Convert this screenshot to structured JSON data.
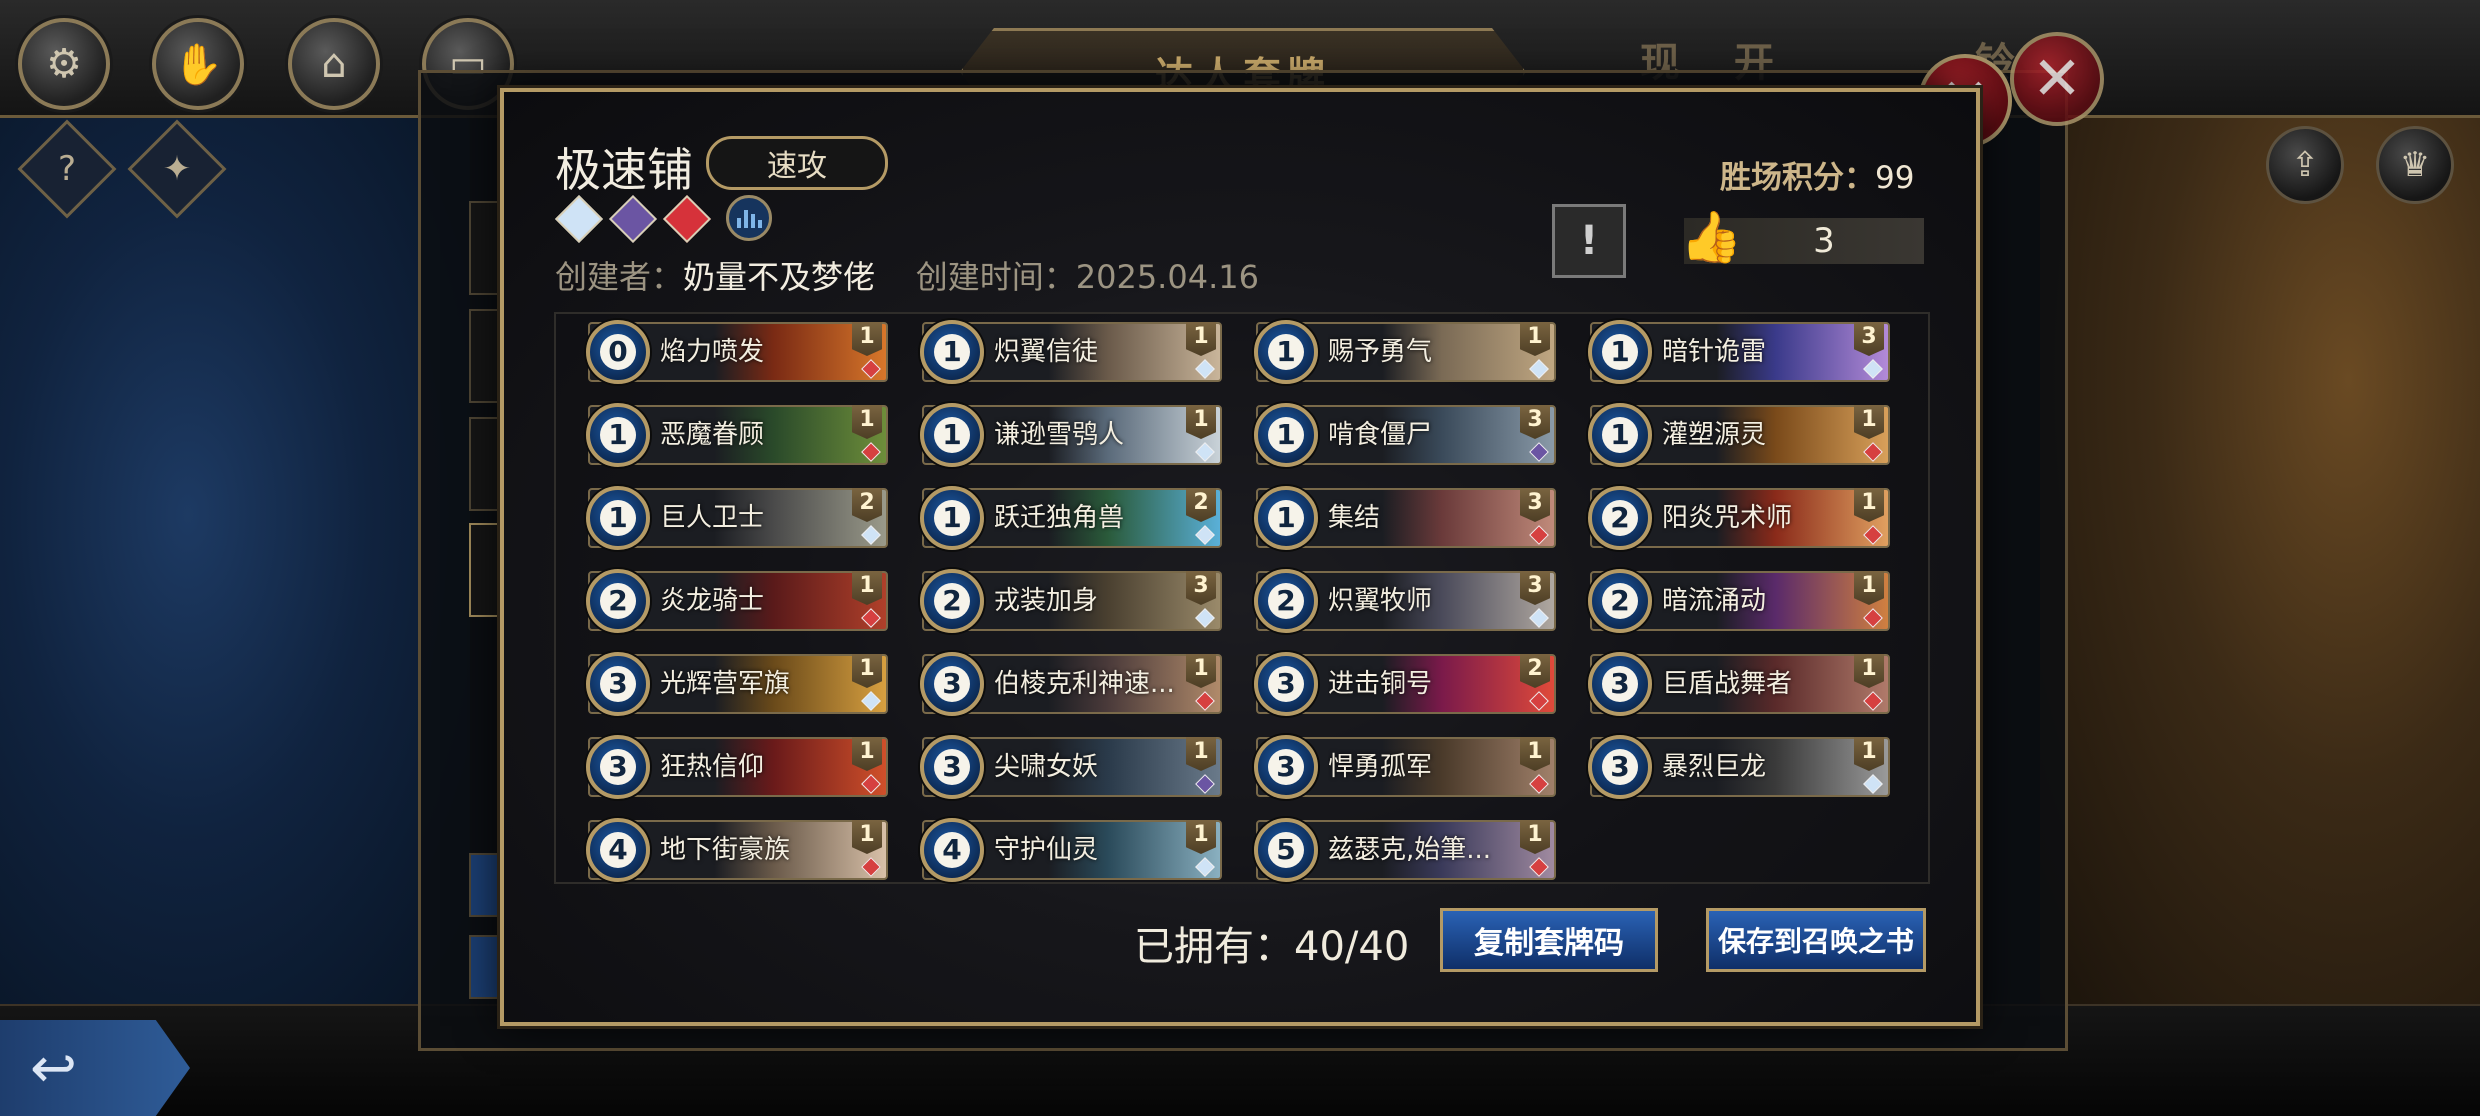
{
  "header": {
    "title": "达人套牌",
    "faded_tab_left": "现  开",
    "faded_tab_right": "铃"
  },
  "deck": {
    "name": "极速铺",
    "tag": "速攻",
    "creator_label": "创建者：",
    "creator": "奶量不及梦佬",
    "created_label": "创建时间：",
    "created_date": "2025.04.16",
    "score_label": "胜场积分：",
    "score": "99",
    "likes": "3",
    "gems": [
      "#cfe3f6",
      "#6b55a3",
      "#d6323a"
    ]
  },
  "cards": [
    {
      "cost": "0",
      "name": "焰力喷发",
      "count": "1",
      "rarity": "#d64040",
      "art1": "#7a2a14",
      "art2": "#d8772a"
    },
    {
      "cost": "1",
      "name": "炽翼信徒",
      "count": "1",
      "rarity": "#cfe3f6",
      "art1": "#6a5a4a",
      "art2": "#c9b59a"
    },
    {
      "cost": "1",
      "name": "赐予勇气",
      "count": "1",
      "rarity": "#cfe3f6",
      "art1": "#7a6a55",
      "art2": "#c0a782"
    },
    {
      "cost": "1",
      "name": "暗针诡雷",
      "count": "3",
      "rarity": "#cfe3f6",
      "art1": "#3a3a8a",
      "art2": "#b38ad8"
    },
    {
      "cost": "1",
      "name": "恶魔眷顾",
      "count": "1",
      "rarity": "#d64040",
      "art1": "#2a4a2a",
      "art2": "#6e8e3a"
    },
    {
      "cost": "1",
      "name": "谦逊雪鸮人",
      "count": "1",
      "rarity": "#cfe3f6",
      "art1": "#5a6a7a",
      "art2": "#c9d2d8"
    },
    {
      "cost": "1",
      "name": "啃食僵尸",
      "count": "3",
      "rarity": "#6b55a3",
      "art1": "#3a4a5a",
      "art2": "#8a9aa8"
    },
    {
      "cost": "1",
      "name": "灌塑源灵",
      "count": "1",
      "rarity": "#d64040",
      "art1": "#7a4a1a",
      "art2": "#d8a05a"
    },
    {
      "cost": "1",
      "name": "巨人卫士",
      "count": "2",
      "rarity": "#cfe3f6",
      "art1": "#4a4a4a",
      "art2": "#9a9a8a"
    },
    {
      "cost": "1",
      "name": "跃迁独角兽",
      "count": "2",
      "rarity": "#cfe3f6",
      "art1": "#2a5a3a",
      "art2": "#5ab0d8"
    },
    {
      "cost": "1",
      "name": "集结",
      "count": "3",
      "rarity": "#d64040",
      "art1": "#6a3a3a",
      "art2": "#c08a7a"
    },
    {
      "cost": "2",
      "name": "阳炎咒术师",
      "count": "1",
      "rarity": "#d64040",
      "art1": "#8a2a1a",
      "art2": "#e0a060"
    },
    {
      "cost": "2",
      "name": "炎龙骑士",
      "count": "1",
      "rarity": "#d64040",
      "art1": "#5a1a1a",
      "art2": "#b0402a"
    },
    {
      "cost": "2",
      "name": "戎装加身",
      "count": "3",
      "rarity": "#cfe3f6",
      "art1": "#4a4030",
      "art2": "#9a8a6a"
    },
    {
      "cost": "2",
      "name": "炽翼牧师",
      "count": "3",
      "rarity": "#cfe3f6",
      "art1": "#4a4a5a",
      "art2": "#b0a8a0"
    },
    {
      "cost": "2",
      "name": "暗流涌动",
      "count": "1",
      "rarity": "#d64040",
      "art1": "#5a2a6a",
      "art2": "#d08040"
    },
    {
      "cost": "3",
      "name": "光辉营军旗",
      "count": "1",
      "rarity": "#cfe3f6",
      "art1": "#6a4a1a",
      "art2": "#d8a040"
    },
    {
      "cost": "3",
      "name": "伯棱克利神速...",
      "count": "1",
      "rarity": "#d64040",
      "art1": "#4a3a3a",
      "art2": "#b08a6a"
    },
    {
      "cost": "3",
      "name": "进击铜号",
      "count": "2",
      "rarity": "#d64040",
      "art1": "#7a1a4a",
      "art2": "#e04a3a"
    },
    {
      "cost": "3",
      "name": "巨盾战舞者",
      "count": "1",
      "rarity": "#d64040",
      "art1": "#5a2a2a",
      "art2": "#b07a6a"
    },
    {
      "cost": "3",
      "name": "狂热信仰",
      "count": "1",
      "rarity": "#d64040",
      "art1": "#6a1a1a",
      "art2": "#d0502a"
    },
    {
      "cost": "3",
      "name": "尖啸女妖",
      "count": "1",
      "rarity": "#6b55a3",
      "art1": "#2a3a4a",
      "art2": "#6a7a8a"
    },
    {
      "cost": "3",
      "name": "悍勇孤军",
      "count": "1",
      "rarity": "#d64040",
      "art1": "#4a3a2a",
      "art2": "#a0806a"
    },
    {
      "cost": "3",
      "name": "暴烈巨龙",
      "count": "1",
      "rarity": "#cfe3f6",
      "art1": "#3a3a3a",
      "art2": "#9a9a9a"
    },
    {
      "cost": "4",
      "name": "地下街豪族",
      "count": "1",
      "rarity": "#d64040",
      "art1": "#6a5a4a",
      "art2": "#d8c0a8"
    },
    {
      "cost": "4",
      "name": "守护仙灵",
      "count": "1",
      "rarity": "#cfe3f6",
      "art1": "#2a4a5a",
      "art2": "#8ab0c0"
    },
    {
      "cost": "5",
      "name": "兹瑟克,始筆...",
      "count": "1",
      "rarity": "#d64040",
      "art1": "#3a3a5a",
      "art2": "#a08aa0"
    }
  ],
  "footer": {
    "owned_label": "已拥有：",
    "owned_value": "40/40",
    "copy_button": "复制套牌码",
    "save_button": "保存到召唤之书"
  },
  "colors": {
    "gold_frame": "#b49a65",
    "button_blue": "#2a62b5",
    "close_red": "#b0232c"
  },
  "icons": {
    "settings": "gear-icon",
    "handshake": "handshake-icon",
    "house": "house-icon",
    "help": "question-icon",
    "gift": "gift-icon",
    "share": "share-icon",
    "trophy": "trophy-icon",
    "back": "back-arrow-icon"
  }
}
